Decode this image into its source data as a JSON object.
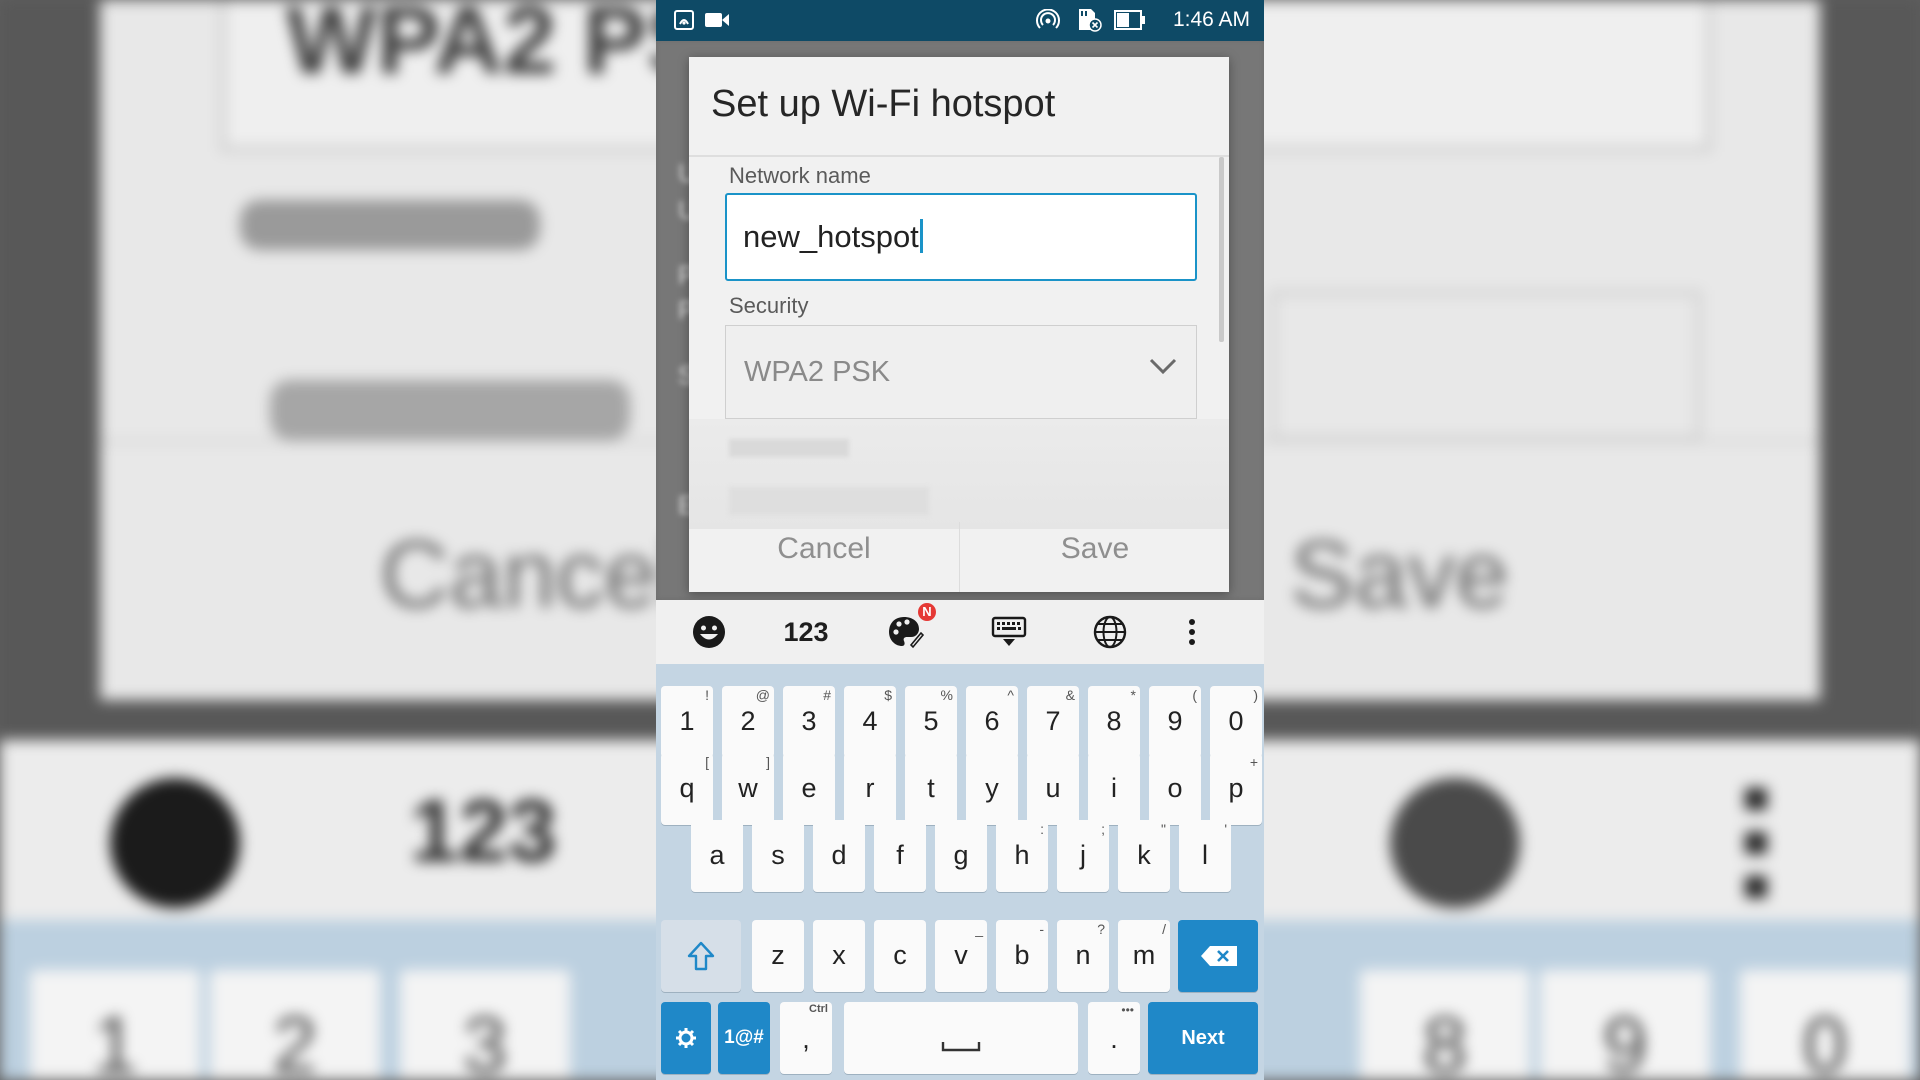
{
  "status_bar": {
    "time": "1:46 AM",
    "left_icons": [
      "nfc-icon",
      "video-camera-icon"
    ],
    "right_icons": [
      "hotspot-icon",
      "sd-card-error-icon",
      "battery-icon"
    ]
  },
  "dialog": {
    "title": "Set up Wi-Fi hotspot",
    "network_name_label": "Network name",
    "network_name_value": "new_hotspot",
    "security_label": "Security",
    "security_value": "WPA2 PSK",
    "cancel_label": "Cancel",
    "save_label": "Save"
  },
  "background": {
    "cancel_text": "Cancel",
    "save_text": "Save",
    "security_text": "WPA2 PSK"
  },
  "keyboard": {
    "toolbar": {
      "numbers_label": "123",
      "badge": "N",
      "icons": [
        "emoji-icon",
        "theme-palette-icon",
        "keyboard-hide-icon",
        "globe-icon",
        "more-vert-icon"
      ]
    },
    "row1": [
      {
        "main": "1",
        "sub": "!"
      },
      {
        "main": "2",
        "sub": "@"
      },
      {
        "main": "3",
        "sub": "#"
      },
      {
        "main": "4",
        "sub": "$"
      },
      {
        "main": "5",
        "sub": "%"
      },
      {
        "main": "6",
        "sub": "^"
      },
      {
        "main": "7",
        "sub": "&"
      },
      {
        "main": "8",
        "sub": "*"
      },
      {
        "main": "9",
        "sub": "("
      },
      {
        "main": "0",
        "sub": ")"
      }
    ],
    "row2": [
      {
        "main": "q",
        "sub": "["
      },
      {
        "main": "w",
        "sub": "]"
      },
      {
        "main": "e",
        "sub": ""
      },
      {
        "main": "r",
        "sub": ""
      },
      {
        "main": "t",
        "sub": ""
      },
      {
        "main": "y",
        "sub": ""
      },
      {
        "main": "u",
        "sub": ""
      },
      {
        "main": "i",
        "sub": ""
      },
      {
        "main": "o",
        "sub": ""
      },
      {
        "main": "p",
        "sub": "+"
      }
    ],
    "row3": [
      {
        "main": "a",
        "sub": ""
      },
      {
        "main": "s",
        "sub": ""
      },
      {
        "main": "d",
        "sub": ""
      },
      {
        "main": "f",
        "sub": ""
      },
      {
        "main": "g",
        "sub": ""
      },
      {
        "main": "h",
        "sub": ":"
      },
      {
        "main": "j",
        "sub": ";"
      },
      {
        "main": "k",
        "sub": "\""
      },
      {
        "main": "l",
        "sub": "'"
      }
    ],
    "row4": [
      {
        "main": "z",
        "sub": ""
      },
      {
        "main": "x",
        "sub": ""
      },
      {
        "main": "c",
        "sub": ""
      },
      {
        "main": "v",
        "sub": "_"
      },
      {
        "main": "b",
        "sub": "-"
      },
      {
        "main": "n",
        "sub": "?"
      },
      {
        "main": "m",
        "sub": "/"
      }
    ],
    "symbols_label": "1@#",
    "comma_label": ",",
    "comma_sub": "Ctrl",
    "period_label": ".",
    "period_sub": "•••",
    "next_label": "Next"
  }
}
